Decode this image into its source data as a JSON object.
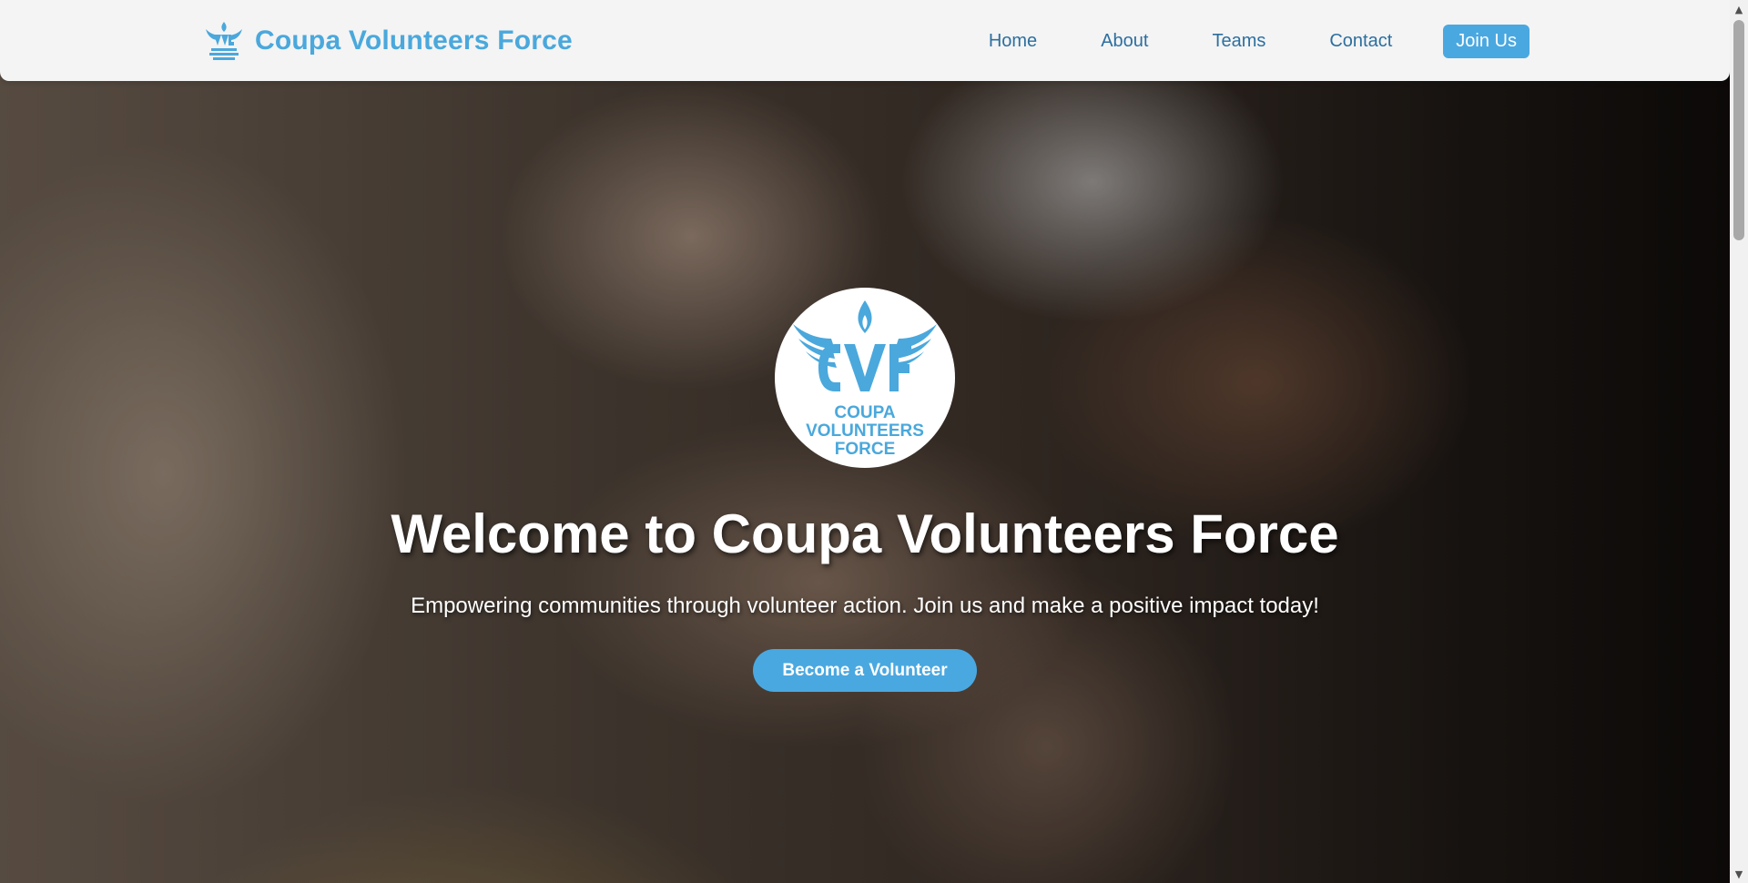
{
  "header": {
    "brand_name": "Coupa Volunteers Force",
    "logo_icon": "cvf-winged-flame-logo",
    "nav": [
      {
        "label": "Home"
      },
      {
        "label": "About"
      },
      {
        "label": "Teams"
      },
      {
        "label": "Contact"
      }
    ],
    "cta_label": "Join Us"
  },
  "hero": {
    "logo_text_line1": "COUPA",
    "logo_text_line2": "VOLUNTEERS",
    "logo_text_line3": "FORCE",
    "title": "Welcome to Coupa Volunteers Force",
    "subtitle": "Empowering communities through volunteer action. Join us and make a positive impact today!",
    "cta_label": "Become a Volunteer",
    "background_image": "stacked-hands-photo"
  },
  "colors": {
    "brand_blue": "#4aa8dc",
    "nav_text": "#2c6f9f",
    "button_blue": "#4aa8e0",
    "navbar_bg": "#f4f4f4"
  }
}
